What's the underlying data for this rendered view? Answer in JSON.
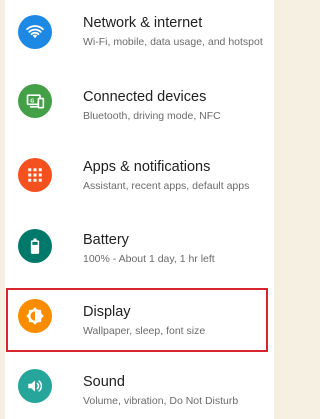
{
  "settings": {
    "items": [
      {
        "title": "Network & internet",
        "subtitle": "Wi-Fi, mobile, data usage, and hotspot",
        "icon": "wifi-icon",
        "color": "#1e88e5"
      },
      {
        "title": "Connected devices",
        "subtitle": "Bluetooth, driving mode, NFC",
        "icon": "connected-devices-icon",
        "color": "#43a047"
      },
      {
        "title": "Apps & notifications",
        "subtitle": "Assistant, recent apps, default apps",
        "icon": "apps-grid-icon",
        "color": "#f4511e"
      },
      {
        "title": "Battery",
        "subtitle": "100% - About 1 day, 1 hr left",
        "icon": "battery-icon",
        "color": "#00796b"
      },
      {
        "title": "Display",
        "subtitle": "Wallpaper, sleep, font size",
        "icon": "brightness-icon",
        "color": "#fb8c00"
      },
      {
        "title": "Sound",
        "subtitle": "Volume, vibration, Do Not Disturb",
        "icon": "volume-icon",
        "color": "#26a69a"
      }
    ]
  },
  "highlight": {
    "target": "Display",
    "color": "#d8262e"
  }
}
